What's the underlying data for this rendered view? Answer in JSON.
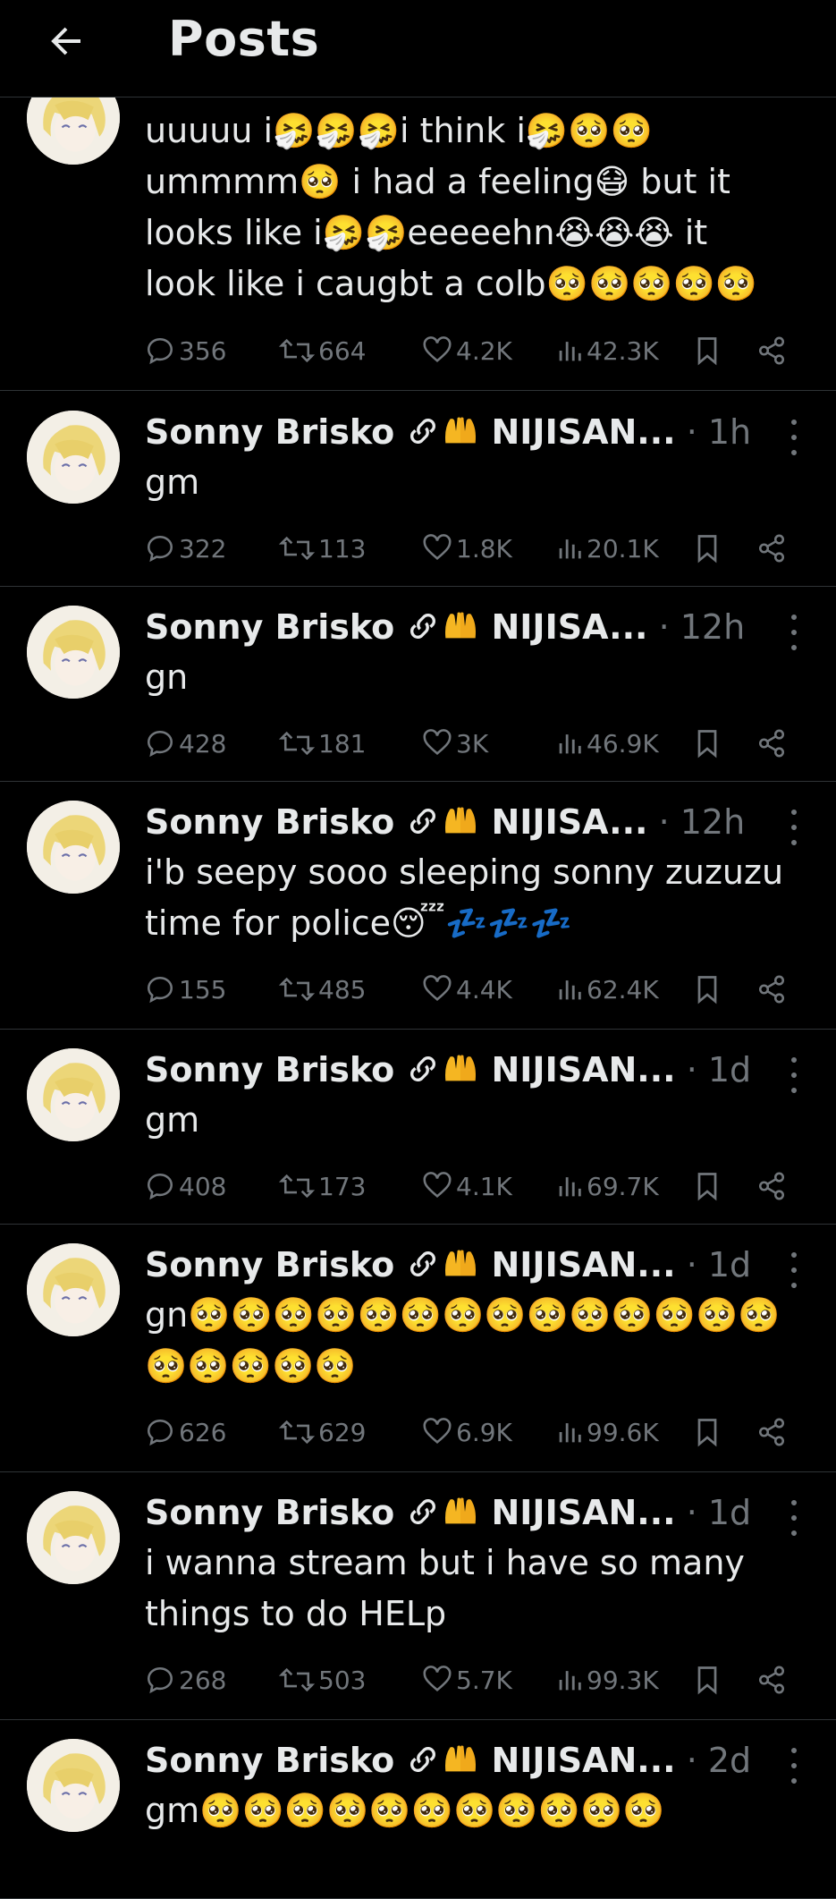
{
  "header": {
    "title": "Posts"
  },
  "posts": [
    {
      "text": "uuuuu i🤧🤧🤧i think i🤧🥺🥺\nummmm🥺 i had a feeling😷 but it\nlooks like i🤧🤧eeeeehn😭😭😭 it\nlook like i caugbt a colb🥺🥺🥺🥺🥺",
      "replies": "356",
      "reposts": "664",
      "likes": "4.2K",
      "views": "42.3K"
    },
    {
      "name": "Sonny Brisko",
      "handle_prefix": "NIJISAN...",
      "time": "· 1h",
      "text": "gm",
      "replies": "322",
      "reposts": "113",
      "likes": "1.8K",
      "views": "20.1K"
    },
    {
      "name": "Sonny Brisko",
      "handle_prefix": "NIJISA...",
      "time": "· 12h",
      "text": "gn",
      "replies": "428",
      "reposts": "181",
      "likes": "3K",
      "views": "46.9K"
    },
    {
      "name": "Sonny Brisko",
      "handle_prefix": "NIJISA...",
      "time": "· 12h",
      "text": "i'b seepy sooo sleeping sonny zuzuzu\ntime for police😴💤💤💤",
      "replies": "155",
      "reposts": "485",
      "likes": "4.4K",
      "views": "62.4K"
    },
    {
      "name": "Sonny Brisko",
      "handle_prefix": "NIJISAN...",
      "time": "· 1d",
      "text": "gm",
      "replies": "408",
      "reposts": "173",
      "likes": "4.1K",
      "views": "69.7K"
    },
    {
      "name": "Sonny Brisko",
      "handle_prefix": "NIJISAN...",
      "time": "· 1d",
      "text": "gn🥺🥺🥺🥺🥺🥺🥺🥺🥺🥺🥺🥺🥺🥺🥺🥺🥺🥺🥺",
      "replies": "626",
      "reposts": "629",
      "likes": "6.9K",
      "views": "99.6K"
    },
    {
      "name": "Sonny Brisko",
      "handle_prefix": "NIJISAN...",
      "time": "· 1d",
      "text": "i wanna stream but i have so many\nthings to do HELp",
      "replies": "268",
      "reposts": "503",
      "likes": "5.7K",
      "views": "99.3K"
    },
    {
      "name": "Sonny Brisko",
      "handle_prefix": "NIJISAN...",
      "time": "· 2d",
      "text": "gm🥺🥺🥺🥺🥺🥺🥺🥺🥺🥺🥺"
    }
  ]
}
